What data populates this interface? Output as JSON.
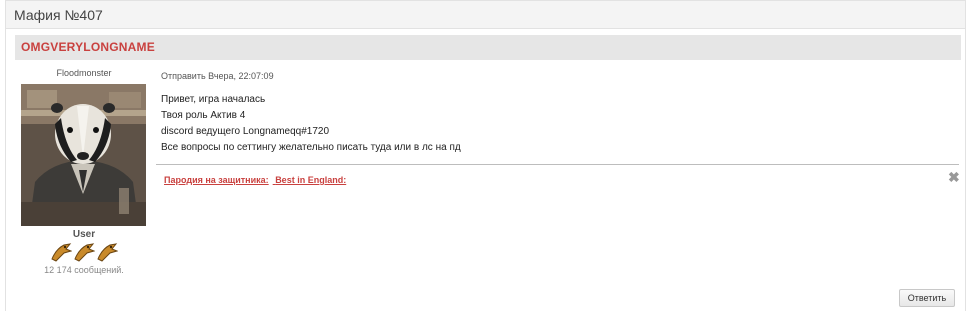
{
  "topic": {
    "title": "Мафия №407"
  },
  "post": {
    "author_banner": "OMGVERYLONGNAME",
    "meta": "Отправить Вчера, 22:07:09",
    "lines": [
      "Привет, игра началась",
      "Твоя роль Актив 4",
      "discord ведущего Longnameqq#1720",
      "Все вопросы по сеттингу желательно писать туда или в лс на пд"
    ],
    "signature": [
      "Пародия на защитника:",
      "Best in England:"
    ],
    "reply_label": "Ответить"
  },
  "user": {
    "nick": "Floodmonster",
    "rank": "User",
    "post_count": "12 174 сообщений."
  },
  "colors": {
    "accent": "#c9413f",
    "banner_bg": "#e6e6e6"
  }
}
